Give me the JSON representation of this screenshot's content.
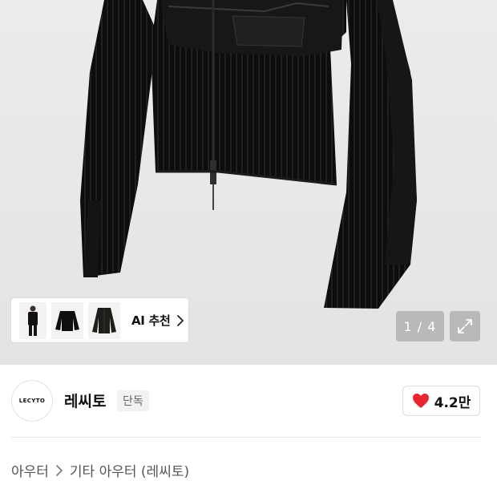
{
  "gallery": {
    "counter": "1 / 4",
    "ai_recommend_label": "AI 추천"
  },
  "brand": {
    "logo_text": "LECYTO",
    "name": "레씨토",
    "badge": "단독"
  },
  "like": {
    "count": "4.2만",
    "heart_color": "#e8262f"
  },
  "breadcrumb": {
    "items": [
      "아우터",
      "기타 아우터 (레씨토)"
    ]
  },
  "icons": [
    "chevron-right-icon",
    "expand-icon",
    "heart-icon"
  ]
}
